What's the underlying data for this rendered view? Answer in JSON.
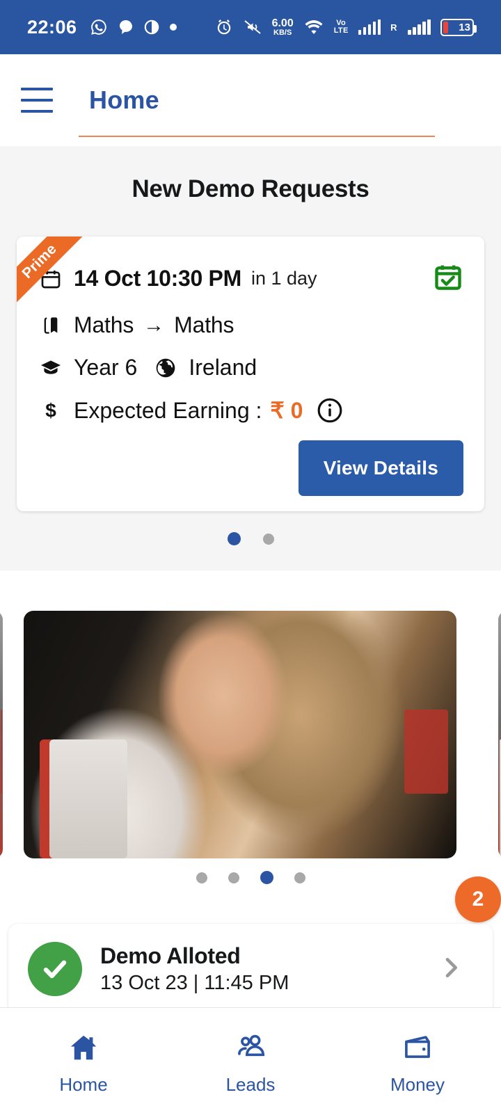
{
  "status_bar": {
    "time": "22:06",
    "network_speed_value": "6.00",
    "network_speed_unit": "KB/S",
    "volte_top": "Vo",
    "volte_bottom": "LTE",
    "roaming_label": "R",
    "battery_level": "13",
    "icons": [
      "whatsapp-icon",
      "chat-bubble-icon",
      "contrast-icon",
      "dot-icon",
      "alarm-icon",
      "mute-icon",
      "wifi-icon",
      "volte-icon",
      "signal-bars-icon",
      "roaming-signal-icon",
      "battery-icon"
    ],
    "background_color": "#2a55a0"
  },
  "header": {
    "menu_icon": "hamburger-menu-icon",
    "title": "Home",
    "title_color": "#2b55a2",
    "underline_color": "#e98a52"
  },
  "demo_section": {
    "title": "New Demo Requests",
    "card": {
      "ribbon_label": "Prime",
      "ribbon_color": "#ea6a26",
      "date": "14 Oct 10:30 PM",
      "relative_time": "in 1 day",
      "calendar_status_icon": "calendar-check-icon",
      "subject_from": "Maths",
      "subject_arrow": "→",
      "subject_to": "Maths",
      "grade": "Year 6",
      "country": "Ireland",
      "earning_label": "Expected Earning :",
      "earning_value": "₹ 0",
      "earning_color": "#ea6a26",
      "info_icon": "info-circle-icon",
      "button_label": "View Details",
      "button_color": "#2a5caa"
    },
    "pagination": {
      "count": 2,
      "active_index": 0
    }
  },
  "carousel": {
    "slides": 4,
    "active_index": 2,
    "image_alt": "smiling-woman-laptop-photo"
  },
  "notification": {
    "badge_count": "2",
    "badge_color": "#ee6a28",
    "status_icon": "green-check-circle-icon",
    "title": "Demo Alloted",
    "timestamp": "13 Oct 23 | 11:45 PM",
    "chevron_icon": "chevron-right-icon"
  },
  "bottom_nav": {
    "items": [
      {
        "label": "Home",
        "icon": "home-icon",
        "active": true
      },
      {
        "label": "Leads",
        "icon": "people-icon",
        "active": false
      },
      {
        "label": "Money",
        "icon": "wallet-icon",
        "active": false
      }
    ],
    "color": "#2b55a2"
  }
}
